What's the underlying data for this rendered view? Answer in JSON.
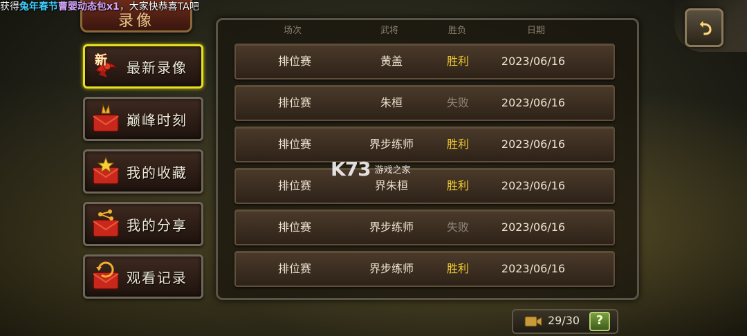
{
  "ticker": {
    "prefix": "获得",
    "highlight1": "兔年春节",
    "highlight2": "曹婴动态包x1",
    "suffix": "，大家快恭喜TA吧"
  },
  "title": "录像",
  "sidebar": {
    "items": [
      {
        "label": "最新录像",
        "icon": "new-ribbon-icon",
        "badge": "新"
      },
      {
        "label": "巅峰时刻",
        "icon": "red-envelope-star-icon"
      },
      {
        "label": "我的收藏",
        "icon": "red-envelope-gold-star-icon"
      },
      {
        "label": "我的分享",
        "icon": "red-envelope-share-icon"
      },
      {
        "label": "观看记录",
        "icon": "red-envelope-history-icon"
      }
    ]
  },
  "table": {
    "headers": [
      "场次",
      "武将",
      "胜负",
      "日期"
    ],
    "rows": [
      {
        "type": "排位赛",
        "general": "黄盖",
        "result": "胜利",
        "date": "2023/06/16"
      },
      {
        "type": "排位赛",
        "general": "朱桓",
        "result": "失败",
        "date": "2023/06/16"
      },
      {
        "type": "排位赛",
        "general": "界步练师",
        "result": "胜利",
        "date": "2023/06/16"
      },
      {
        "type": "排位赛",
        "general": "界朱桓",
        "result": "胜利",
        "date": "2023/06/16"
      },
      {
        "type": "排位赛",
        "general": "界步练师",
        "result": "失败",
        "date": "2023/06/16"
      },
      {
        "type": "排位赛",
        "general": "界步练师",
        "result": "胜利",
        "date": "2023/06/16"
      }
    ]
  },
  "footer": {
    "count": "29/30",
    "help_label": "?"
  },
  "watermark": {
    "logo": "K73",
    "text": "游戏之家"
  },
  "colors": {
    "win": "#f2cc30",
    "lose": "#8e877a",
    "active_border": "#e8df20"
  }
}
